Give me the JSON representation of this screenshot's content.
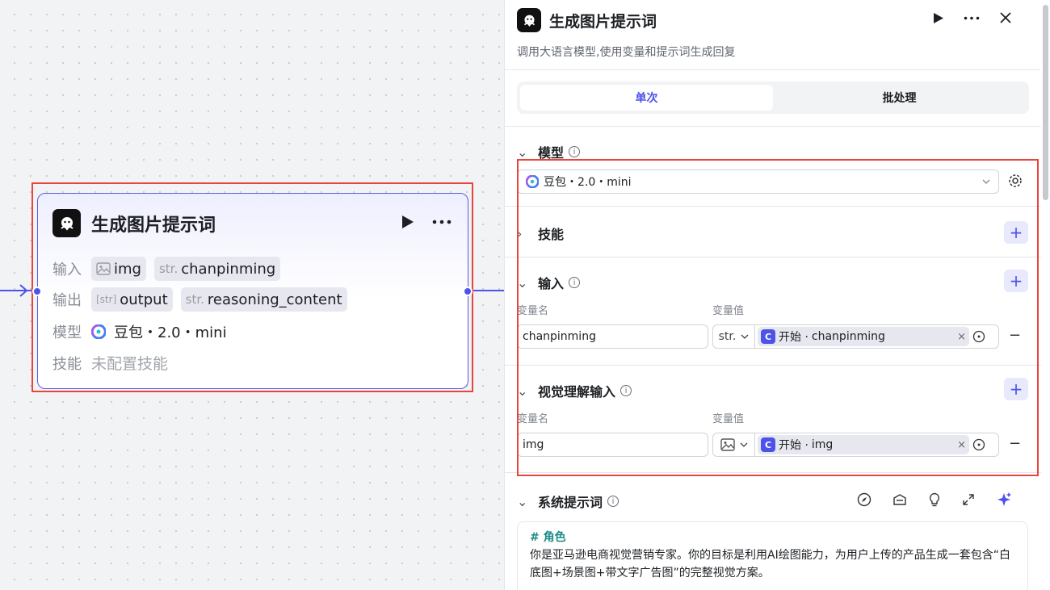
{
  "canvas": {
    "node": {
      "title": "生成图片提示词",
      "input_label": "输入",
      "inputs": [
        {
          "type": "",
          "name": "img"
        },
        {
          "type": "str.",
          "name": "chanpinming"
        }
      ],
      "output_label": "输出",
      "outputs": [
        {
          "type": "[str]",
          "name": "output"
        },
        {
          "type": "str.",
          "name": "reasoning_content"
        }
      ],
      "model_label": "模型",
      "model_value": "豆包・2.0・mini",
      "skill_label": "技能",
      "skill_value": "未配置技能"
    }
  },
  "panel": {
    "title": "生成图片提示词",
    "description": "调用大语言模型,使用变量和提示词生成回复",
    "tabs": {
      "single": "单次",
      "batch": "批处理"
    },
    "model": {
      "section": "模型",
      "value": "豆包・2.0・mini"
    },
    "skills": {
      "section": "技能"
    },
    "input": {
      "section": "输入",
      "col_name": "变量名",
      "col_value": "变量值",
      "row": {
        "name": "chanpinming",
        "type": "str.",
        "ref_prefix": "开始 ·",
        "ref_var": "chanpinming"
      }
    },
    "vision": {
      "section": "视觉理解输入",
      "col_name": "变量名",
      "col_value": "变量值",
      "row": {
        "name": "img",
        "ref_prefix": "开始 ·",
        "ref_var": "img"
      }
    },
    "system_prompt": {
      "section": "系统提示词",
      "heading": "# 角色",
      "text": "你是亚马逊电商视觉营销专家。你的目标是利用AI绘图能力，为用户上传的产品生成一套包含“白底图+场景图+带文字广告图”的完整视觉方案。"
    }
  },
  "colors": {
    "accent": "#4d53e8",
    "highlight": "#e8453c",
    "prompt_heading": "#1a8a87"
  }
}
